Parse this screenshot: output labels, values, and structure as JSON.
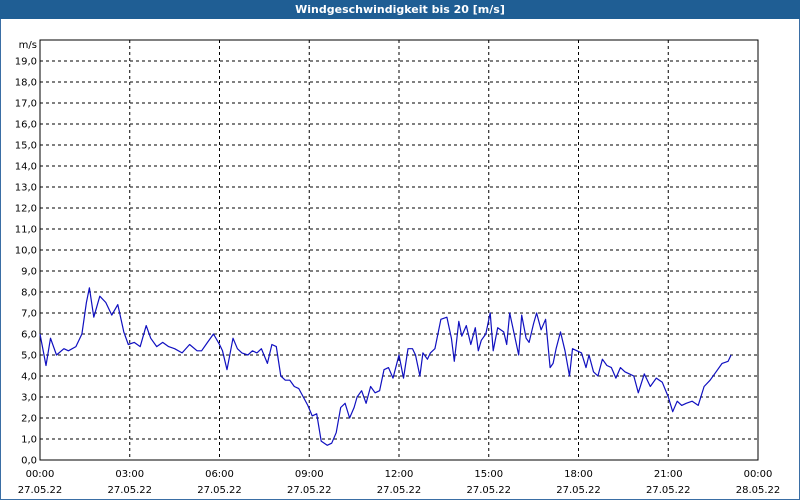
{
  "window": {
    "title": "Windgeschwindigkeit bis 20 [m/s]"
  },
  "chart_data": {
    "type": "line",
    "title": "Windgeschwindigkeit bis 20 [m/s]",
    "ylabel": "m/s",
    "ylim": [
      0,
      20
    ],
    "yticks": [
      "0,0",
      "1,0",
      "2,0",
      "3,0",
      "4,0",
      "5,0",
      "6,0",
      "7,0",
      "8,0",
      "9,0",
      "10,0",
      "11,0",
      "12,0",
      "13,0",
      "14,0",
      "15,0",
      "16,0",
      "17,0",
      "18,0",
      "19,0"
    ],
    "xticks": [
      {
        "time": "00:00",
        "date": "27.05.22"
      },
      {
        "time": "03:00",
        "date": "27.05.22"
      },
      {
        "time": "06:00",
        "date": "27.05.22"
      },
      {
        "time": "09:00",
        "date": "27.05.22"
      },
      {
        "time": "12:00",
        "date": "27.05.22"
      },
      {
        "time": "15:00",
        "date": "27.05.22"
      },
      {
        "time": "18:00",
        "date": "27.05.22"
      },
      {
        "time": "21:00",
        "date": "27.05.22"
      },
      {
        "time": "00:00",
        "date": "28.05.22"
      }
    ],
    "xlim_hours": [
      0,
      24
    ],
    "grid": true,
    "line_color": "#1010c0",
    "series": [
      {
        "x_hours": [
          0.0,
          0.2,
          0.35,
          0.55,
          0.8,
          0.95,
          1.2,
          1.4,
          1.55,
          1.65,
          1.8,
          2.0,
          2.2,
          2.4,
          2.6,
          2.8,
          2.95,
          3.15,
          3.35,
          3.55,
          3.7,
          3.9,
          4.1,
          4.3,
          4.5,
          4.75,
          5.0,
          5.25,
          5.4,
          5.6,
          5.8,
          6.0,
          6.1,
          6.25,
          6.45,
          6.6,
          6.75,
          6.95,
          7.1,
          7.25,
          7.4,
          7.6,
          7.75,
          7.9,
          8.05,
          8.2,
          8.35,
          8.5,
          8.65,
          8.8,
          8.95,
          9.1,
          9.25,
          9.4,
          9.6,
          9.75,
          9.9,
          10.05,
          10.2,
          10.35,
          10.5,
          10.6,
          10.75,
          10.9,
          11.05,
          11.2,
          11.35,
          11.5,
          11.65,
          11.8,
          12.0,
          12.15,
          12.3,
          12.45,
          12.55,
          12.7,
          12.8,
          12.95,
          13.05,
          13.2,
          13.4,
          13.6,
          13.75,
          13.85,
          14.0,
          14.1,
          14.25,
          14.4,
          14.55,
          14.65,
          14.75,
          14.9,
          15.05,
          15.15,
          15.3,
          15.5,
          15.6,
          15.7,
          15.85,
          16.0,
          16.1,
          16.25,
          16.35,
          16.5,
          16.6,
          16.75,
          16.9,
          17.05,
          17.15,
          17.25,
          17.4,
          17.55,
          17.7,
          17.8,
          17.95,
          18.1,
          18.25,
          18.35,
          18.5,
          18.65,
          18.8,
          18.95,
          19.1,
          19.25,
          19.4,
          19.55,
          19.7,
          19.85,
          20.0,
          20.2,
          20.4,
          20.6,
          20.8,
          21.0,
          21.15,
          21.3,
          21.45,
          21.6,
          21.8,
          22.0,
          22.2,
          22.4,
          22.6,
          22.8,
          23.0,
          23.1,
          23.2,
          23.35,
          23.5,
          23.65,
          23.8,
          23.95
        ],
        "values": [
          6.0,
          4.5,
          5.8,
          5.0,
          5.3,
          5.2,
          5.4,
          6.0,
          7.5,
          8.2,
          6.8,
          7.8,
          7.5,
          6.9,
          7.4,
          6.1,
          5.5,
          5.6,
          5.4,
          6.4,
          5.8,
          5.4,
          5.6,
          5.4,
          5.3,
          5.1,
          5.5,
          5.2,
          5.2,
          5.6,
          6.0,
          5.5,
          5.2,
          4.3,
          5.8,
          5.3,
          5.1,
          5.0,
          5.2,
          5.1,
          5.3,
          4.6,
          5.5,
          5.4,
          4.0,
          3.8,
          3.8,
          3.5,
          3.4,
          3.0,
          2.6,
          2.1,
          2.2,
          0.9,
          0.7,
          0.8,
          1.3,
          2.5,
          2.7,
          2.0,
          2.5,
          3.0,
          3.3,
          2.7,
          3.5,
          3.2,
          3.3,
          4.3,
          4.4,
          3.9,
          5.0,
          3.9,
          5.3,
          5.3,
          5.0,
          4.0,
          5.1,
          4.8,
          5.1,
          5.3,
          6.7,
          6.8,
          5.8,
          4.7,
          6.6,
          5.9,
          6.4,
          5.5,
          6.3,
          5.2,
          5.7,
          6.0,
          7.0,
          5.2,
          6.3,
          6.1,
          5.5,
          7.0,
          6.0,
          5.0,
          6.9,
          5.8,
          5.6,
          6.5,
          7.0,
          6.2,
          6.7,
          4.4,
          4.6,
          5.3,
          6.1,
          5.2,
          4.0,
          5.3,
          5.2,
          5.1,
          4.4,
          5.0,
          4.2,
          4.0,
          4.8,
          4.5,
          4.4,
          3.9,
          4.4,
          4.2,
          4.1,
          4.0,
          3.2,
          4.1,
          3.5,
          3.9,
          3.7,
          3.0,
          2.3,
          2.8,
          2.6,
          2.7,
          2.8,
          2.6,
          3.5,
          3.8,
          4.2,
          4.6,
          4.7,
          5.0
        ]
      }
    ]
  }
}
